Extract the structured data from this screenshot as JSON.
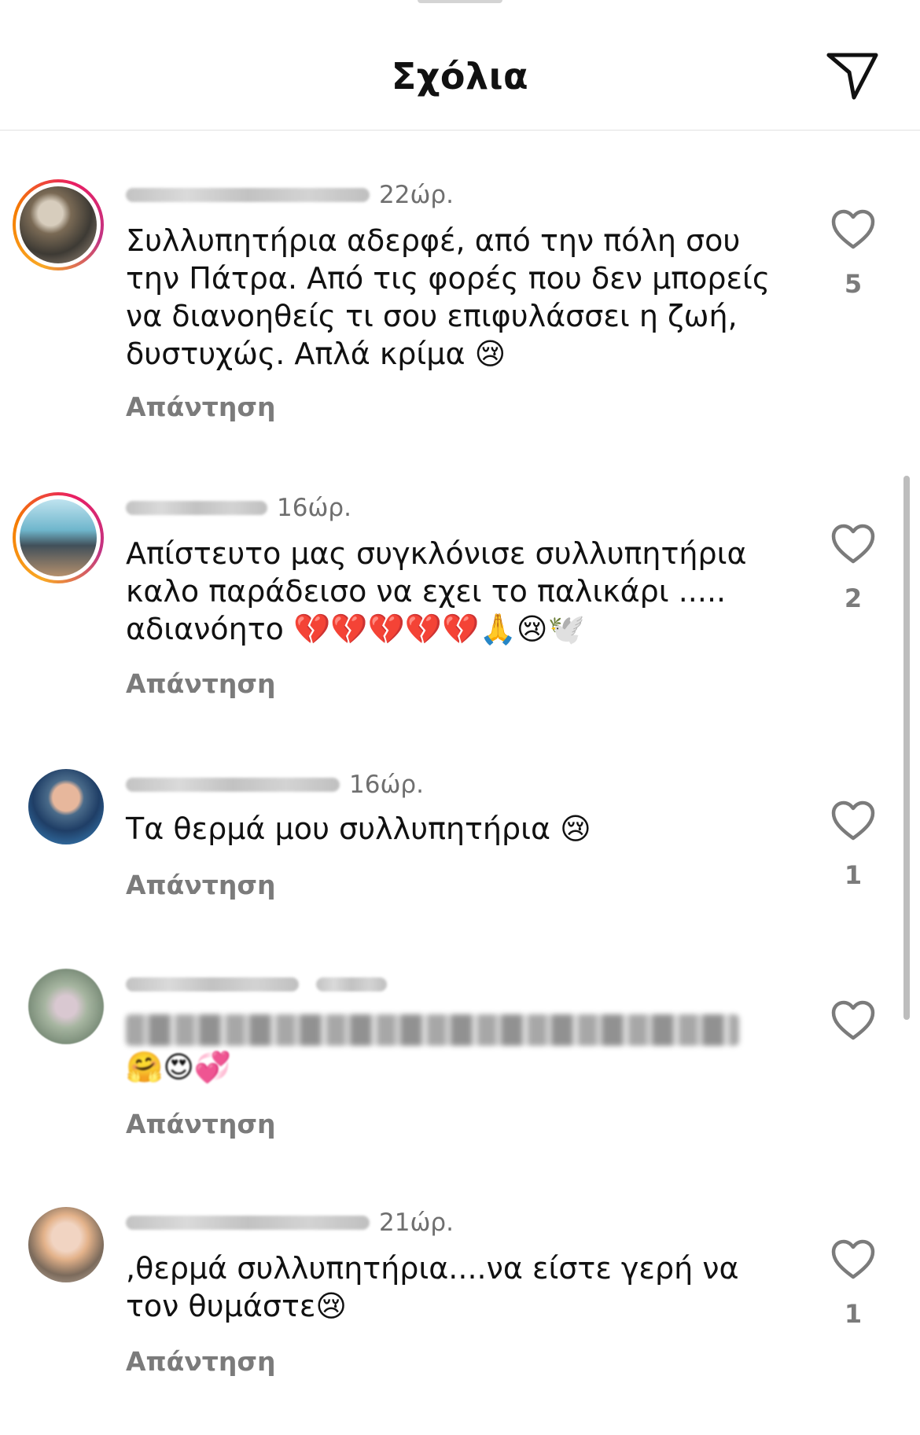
{
  "header": {
    "title": "Σχόλια",
    "send_icon": "paper-plane-icon"
  },
  "comments": [
    {
      "time": "22ώρ.",
      "text": "Συλλυπητήρια αδερφέ, από την πόλη σου\nτην Πάτρα. Από τις φορές που δεν μπορείς\nνα διανοηθείς τι σου επιφυλάσσει η ζωή,\nδυστυχώς. Απλά κρίμα 😢",
      "reply": "Απάντηση",
      "likes": "5"
    },
    {
      "time": "16ώρ.",
      "text": "Απίστευτο μας συγκλόνισε συλλυπητήρια\nκαλο παράδεισο να εχει το παλικάρι .....\nαδιανόητο 💔💔💔💔💔🙏😢🕊️",
      "reply": "Απάντηση",
      "likes": "2"
    },
    {
      "time": "16ώρ.",
      "text": "Τα θερμά μου συλλυπητήρια 😢",
      "reply": "Απάντηση",
      "likes": "1"
    },
    {
      "time": "",
      "emojis": "🤗😍💞",
      "reply": "Απάντηση",
      "likes": ""
    },
    {
      "time": "21ώρ.",
      "text": ",θερμά συλλυπητήρια....να είστε γερή να\nτον θυμάστε😢",
      "reply": "Απάντηση",
      "likes": "1"
    }
  ]
}
